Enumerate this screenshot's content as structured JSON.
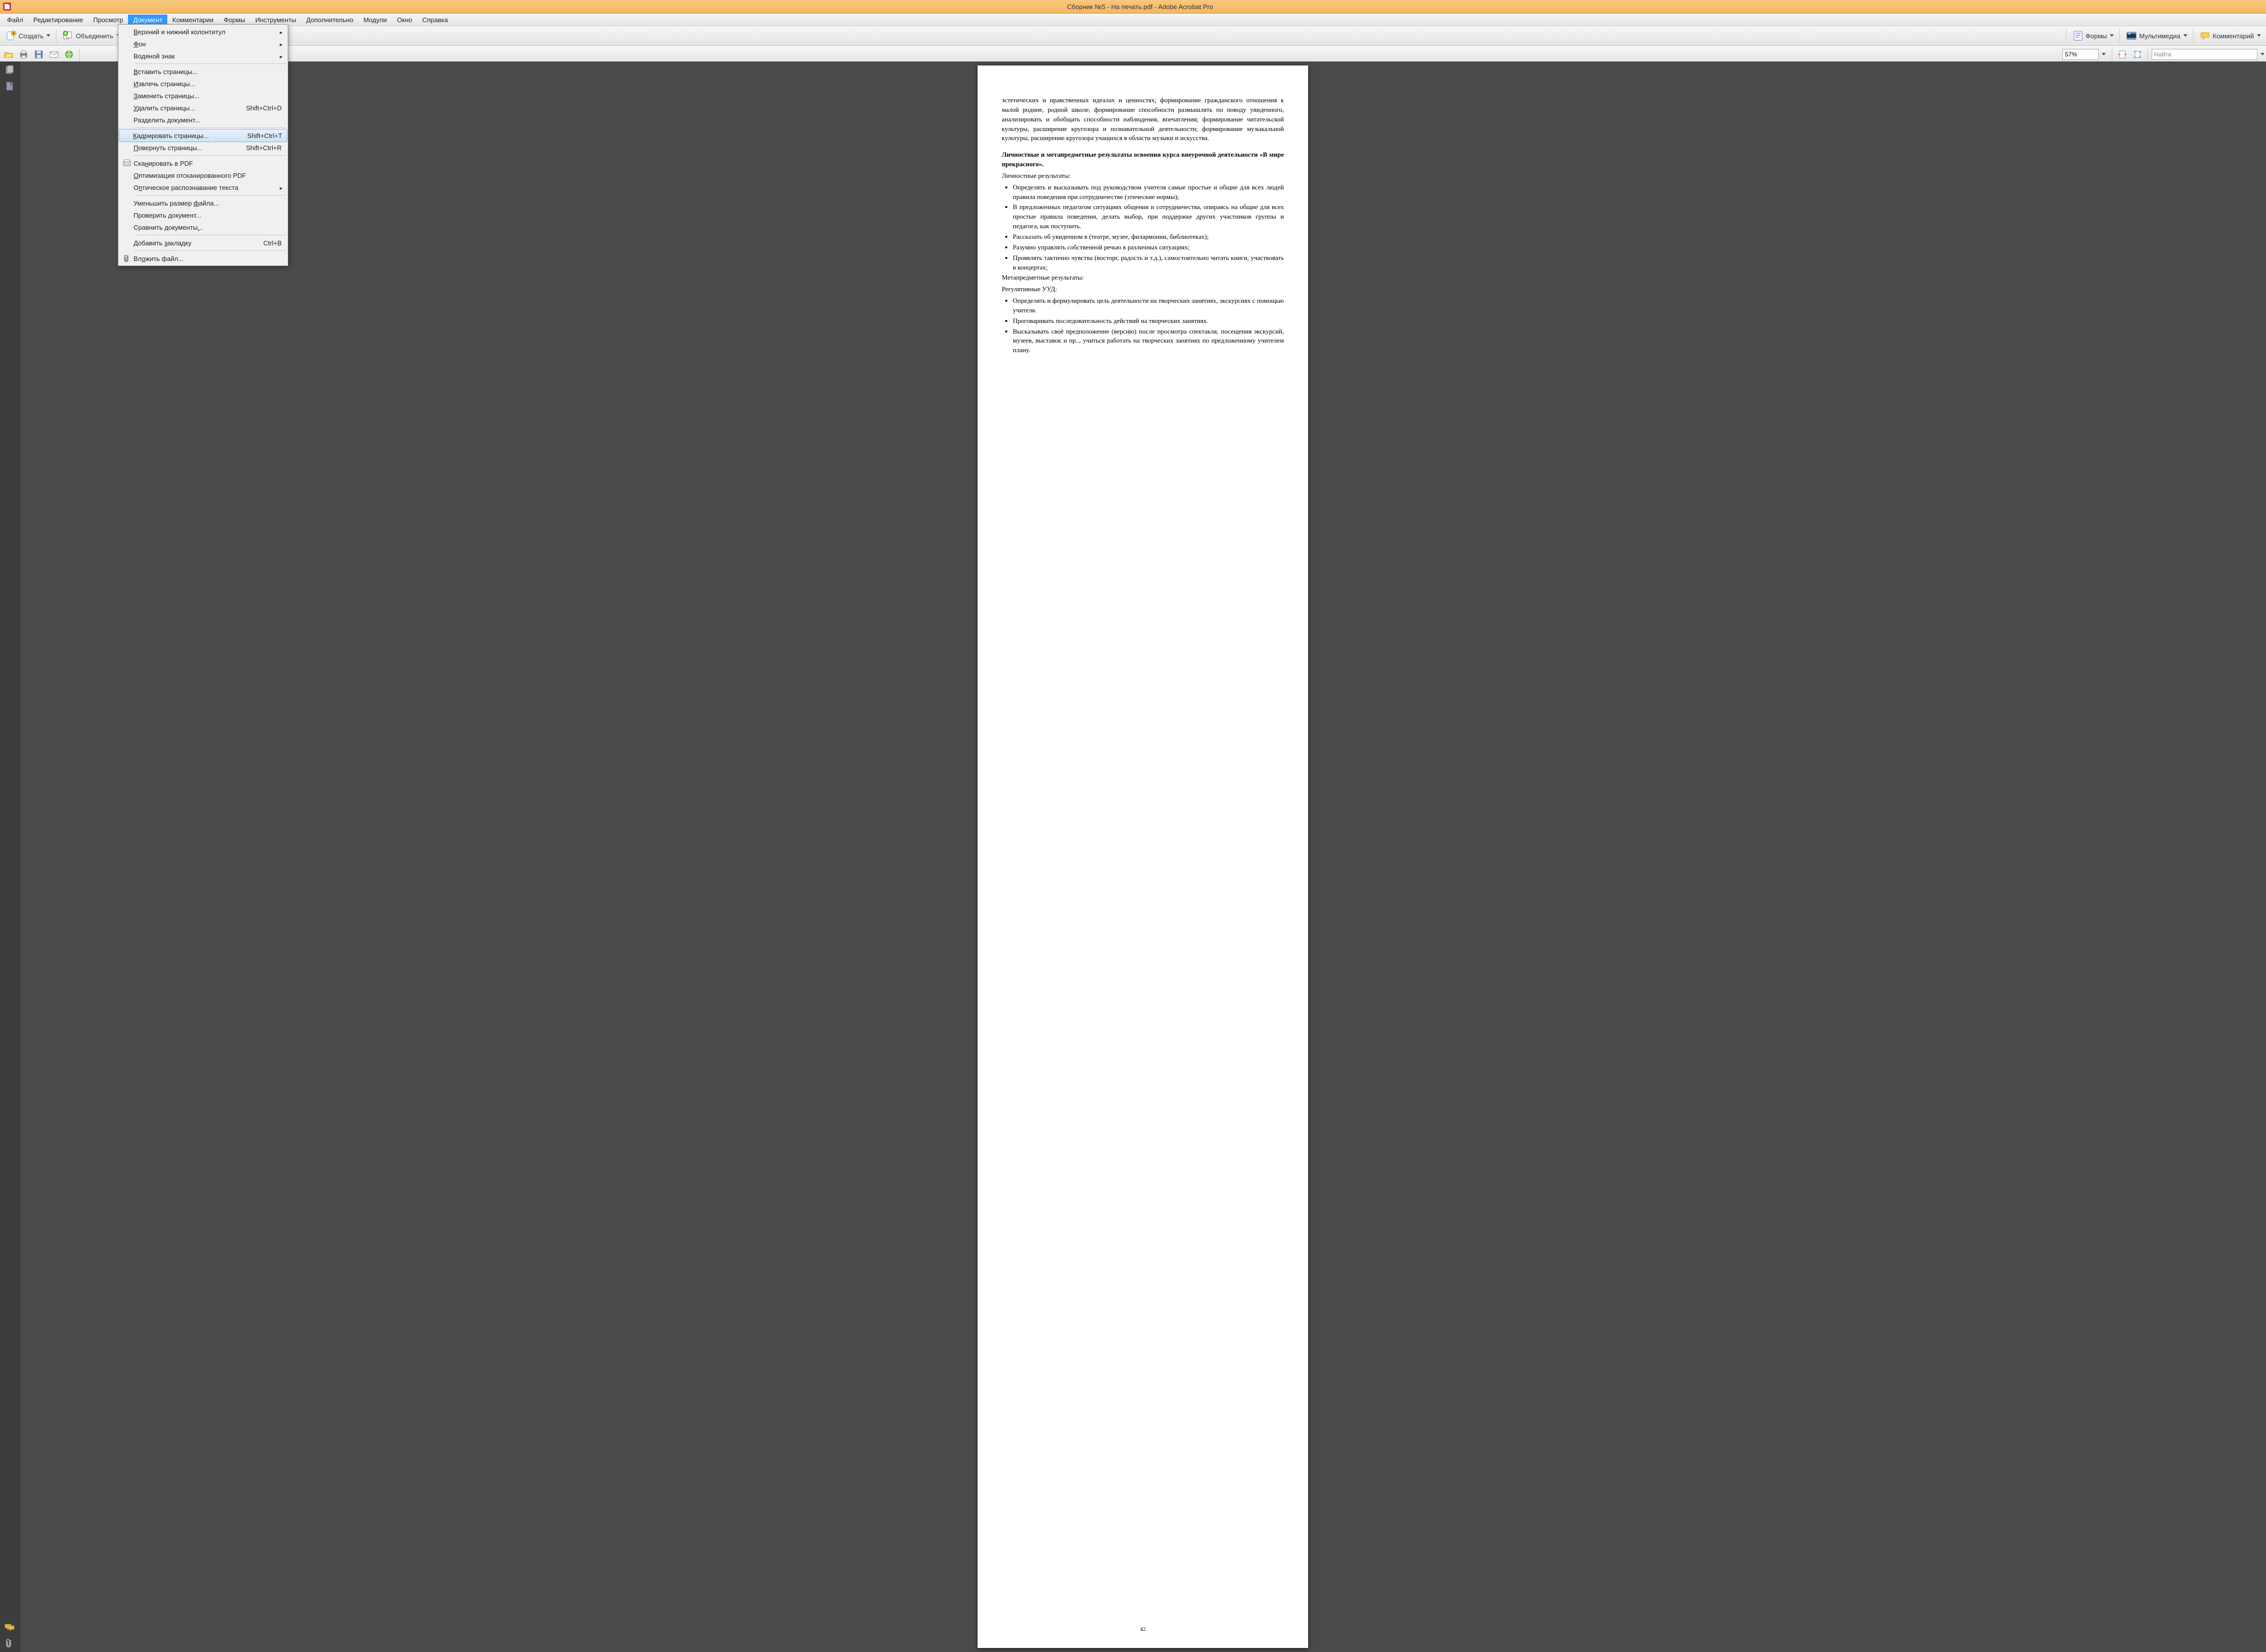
{
  "title": "Сборник №5 - На печать.pdf - Adobe Acrobat Pro",
  "menubar": [
    "Файл",
    "Редактирование",
    "Просмотр",
    "Документ",
    "Комментарии",
    "Формы",
    "Инструменты",
    "Дополнительно",
    "Модули",
    "Окно",
    "Справка"
  ],
  "menubar_active_index": 3,
  "toolbar1": {
    "create": "Создать",
    "combine": "Объединить",
    "forms": "Формы",
    "multimedia": "Мультимедиа",
    "comment": "Комментарий"
  },
  "toolbar2": {
    "zoom": "57%",
    "find_placeholder": "Найти"
  },
  "dropdown": {
    "items": [
      {
        "label": "Верхний и нижний колонтитул",
        "u": 0,
        "sub": true
      },
      {
        "label": "Фон",
        "u": 0,
        "sub": true
      },
      {
        "label": "Водяной знак",
        "u": 2,
        "sub": true
      },
      {
        "sep": true
      },
      {
        "label": "Вставить страницы...",
        "u": 0
      },
      {
        "label": "Извлечь страницы...",
        "u": 0
      },
      {
        "label": "Заменить страницы...",
        "u": 0
      },
      {
        "label": "Удалить страницы...",
        "u": 0,
        "shortcut": "Shift+Ctrl+D"
      },
      {
        "label": "Разделить документ...",
        "u": 3
      },
      {
        "sep": true
      },
      {
        "label": "Кадрировать страницы...",
        "u": 0,
        "shortcut": "Shift+Ctrl+T",
        "hover": true
      },
      {
        "label": "Повернуть страницы...",
        "u": 0,
        "shortcut": "Shift+Ctrl+R"
      },
      {
        "sep": true
      },
      {
        "label": "Сканировать в PDF",
        "u": 3,
        "icon": "scan"
      },
      {
        "label": "Оптимизация отсканированного PDF",
        "u": 0
      },
      {
        "label": "Оптическое распознавание текста",
        "u": 1,
        "sub": true
      },
      {
        "sep": true
      },
      {
        "label": "Уменьшить размер файла...",
        "u": 17
      },
      {
        "label": "Проверить документ...",
        "u": 10
      },
      {
        "label": "Сравнить документы...",
        "u": 18
      },
      {
        "sep": true
      },
      {
        "label": "Добавить закладку",
        "u": 9,
        "shortcut": "Ctrl+B"
      },
      {
        "sep": true
      },
      {
        "label": "Вложить файл...",
        "u": 2,
        "icon": "attach"
      }
    ]
  },
  "doc": {
    "para1": "эстетических и нравственных идеалах и ценностях; формирование гражданского отношения к малой родине, родной школе, формирование способности размышлять по поводу увиденного, анализировать и обобщать способности наблюдения, впечатления; формирование читательской культуры, расширение кругозора и познавательной деятельности; формирование музыкальной культуры, расширение кругозора учащихся в области музыки и искусства.",
    "h1": "Личностные и метапредметные результаты освоения курса внеурочной деятельности «В мире прекрасного».",
    "p2": "Личностные результаты:",
    "bullets1": [
      "Определять и высказывать под руководством учителя самые простые и общие для всех людей правила поведения при сотрудничестве (этические нормы);",
      "В предложенных педагогом ситуациях общения и сотрудничества, опираясь на общие для всех простые правила поведения, делать выбор, при поддержке других участников группы и педагога, как поступить.",
      "Рассказать об увиденном в (театре, музее, филармонии, библиотеках);",
      "Разумно управлять собственной речью в различных ситуациях;",
      "Проявлять тактично чувства (восторг, радость и т.д.), самостоятельно читать книги, участвовать в концертах;"
    ],
    "p3": "Метапредметные результаты:",
    "p4": "Регулятивные УУД:",
    "bullets2": [
      "Определять и формулировать цель деятельности на творческих занятиях, экскурсиях с помощью учителя.",
      "Проговаривать последовательность действий на творческих занятиях.",
      "Высказывать своё предположение (версию) после просмотра спектакля, посещения экскурсий, музеев, выставок и пр.., учиться работать на творческих занятиях по предложенному учителем плану."
    ],
    "page_num": "42"
  }
}
